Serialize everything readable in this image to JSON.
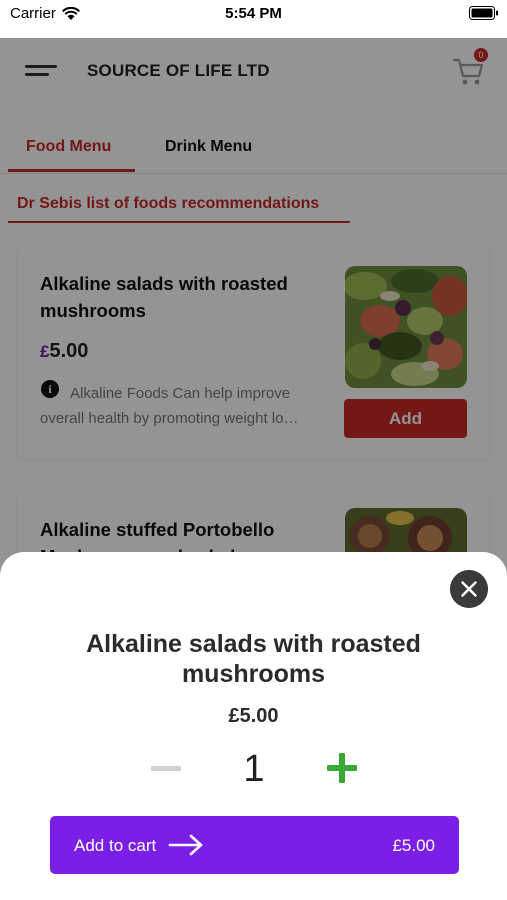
{
  "status_bar": {
    "carrier": "Carrier",
    "time": "5:54 PM"
  },
  "header": {
    "title": "SOURCE OF LIFE LTD",
    "cart_count": "0"
  },
  "tabs": [
    {
      "label": "Food Menu",
      "active": true
    },
    {
      "label": "Drink Menu",
      "active": false
    }
  ],
  "section": {
    "title": "Dr Sebis list of foods recommendations"
  },
  "menu_items": [
    {
      "name": "Alkaline salads with roasted mushrooms",
      "currency": "£",
      "amount": "5.00",
      "description": "Alkaline Foods Can help improve overall health by promoting weight lo…",
      "add_label": "Add"
    },
    {
      "name": "Alkaline stuffed Portobello Mushrooms and salads"
    }
  ],
  "sheet": {
    "title": "Alkaline salads with roasted mushrooms",
    "price": "£5.00",
    "quantity": "1",
    "add_to_cart_label": "Add to cart",
    "total": "£5.00"
  },
  "colors": {
    "brand_red": "#c62828",
    "accent_purple": "#7b1fe6",
    "plus_green": "#3aa835"
  }
}
